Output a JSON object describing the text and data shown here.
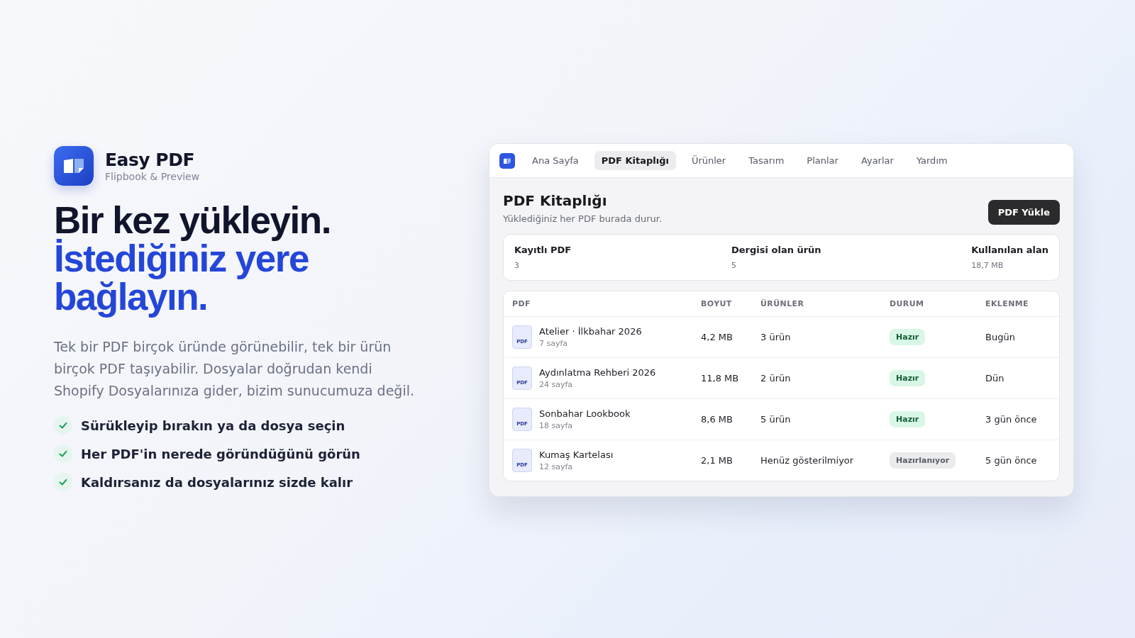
{
  "brand": {
    "name": "Easy PDF",
    "tagline": "Flipbook & Preview"
  },
  "headline": [
    {
      "text": "Bir kez yükleyin.",
      "kind": "dark"
    },
    {
      "text": "İstediğiniz yere bağlayın.",
      "kind": "accent"
    }
  ],
  "intro": "Tek bir PDF birçok üründe görünebilir, tek bir ürün birçok PDF taşıyabilir. Dosyalar doğrudan kendi Shopify Dosyalarınıza gider, bizim sunucumuza değil.",
  "features": [
    "Sürükleyip bırakın ya da dosya seçin",
    "Her PDF'in nerede göründüğünü görün",
    "Kaldırsanız da dosyalarınız sizde kalır"
  ],
  "app": {
    "tabs": [
      {
        "label": "Ana Sayfa",
        "selected": false
      },
      {
        "label": "PDF Kitaplığı",
        "selected": true
      },
      {
        "label": "Ürünler",
        "selected": false
      },
      {
        "label": "Tasarım",
        "selected": false
      },
      {
        "label": "Planlar",
        "selected": false
      },
      {
        "label": "Ayarlar",
        "selected": false
      },
      {
        "label": "Yardım",
        "selected": false
      }
    ],
    "page_title": "PDF Kitaplığı",
    "page_subtitle": "Yüklediğiniz her PDF burada durur.",
    "upload_button": "PDF Yükle",
    "stats": [
      {
        "label": "Kayıtlı PDF",
        "value": "3"
      },
      {
        "label": "Dergisi olan ürün",
        "value": "5"
      },
      {
        "label": "Kullanılan alan",
        "value": "18,7 MB"
      }
    ],
    "table": {
      "columns": [
        "PDF",
        "BOYUT",
        "ÜRÜNLER",
        "DURUM",
        "EKLENME"
      ],
      "rows": [
        {
          "icon": "PDF",
          "name": "Atelier · İlkbahar 2026",
          "pages": "7 sayfa",
          "size": "4,2 MB",
          "products": "3 ürün",
          "status": "Hazır",
          "kind": "ready",
          "added": "Bugün"
        },
        {
          "icon": "PDF",
          "name": "Aydınlatma Rehberi 2026",
          "pages": "24 sayfa",
          "size": "11,8 MB",
          "products": "2 ürün",
          "status": "Hazır",
          "kind": "ready",
          "added": "Dün"
        },
        {
          "icon": "PDF",
          "name": "Sonbahar Lookbook",
          "pages": "18 sayfa",
          "size": "8,6 MB",
          "products": "5 ürün",
          "status": "Hazır",
          "kind": "ready",
          "added": "3 gün önce"
        },
        {
          "icon": "PDF",
          "name": "Kumaş Kartelası",
          "pages": "12 sayfa",
          "size": "2,1 MB",
          "products": "Henüz gösterilmiyor",
          "status": "Hazırlanıyor",
          "kind": "preparing",
          "added": "5 gün önce"
        }
      ]
    }
  }
}
